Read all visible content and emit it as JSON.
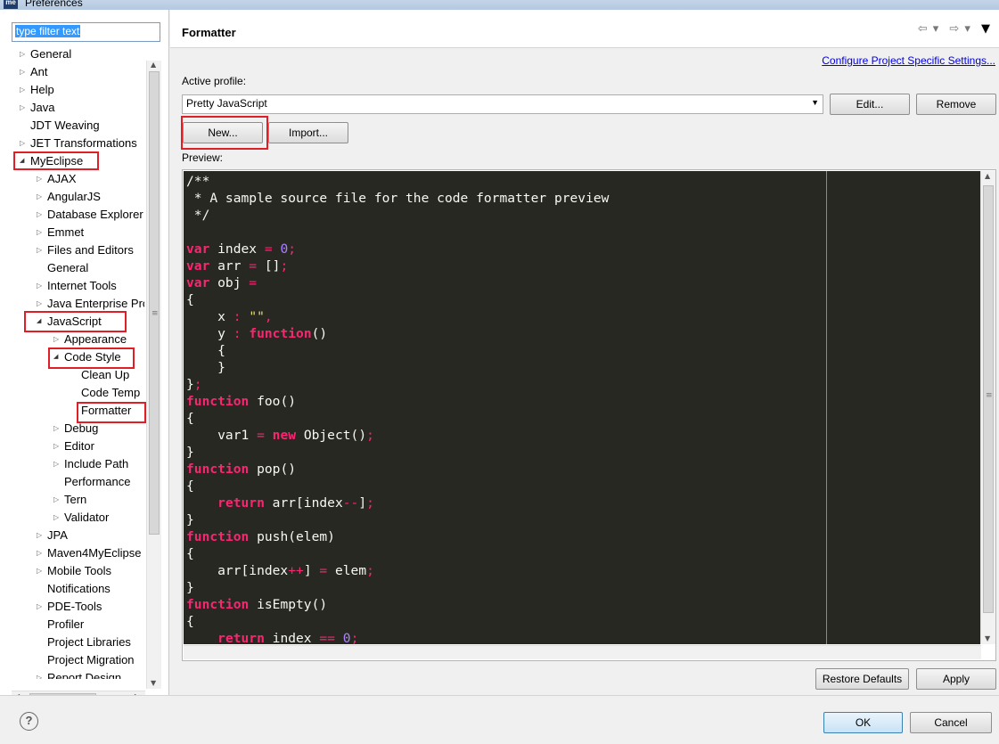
{
  "window": {
    "title": "Preferences",
    "app_icon": "me"
  },
  "filter": {
    "value": "type filter text"
  },
  "tree": [
    {
      "label": "General",
      "arrow": "▷",
      "level": 0
    },
    {
      "label": "Ant",
      "arrow": "▷",
      "level": 0
    },
    {
      "label": "Help",
      "arrow": "▷",
      "level": 0
    },
    {
      "label": "Java",
      "arrow": "▷",
      "level": 0
    },
    {
      "label": "JDT Weaving",
      "arrow": "",
      "level": 0
    },
    {
      "label": "JET Transformations",
      "arrow": "▷",
      "level": 0
    },
    {
      "label": "MyEclipse",
      "arrow": "◢",
      "level": 0
    },
    {
      "label": "AJAX",
      "arrow": "▷",
      "level": 1
    },
    {
      "label": "AngularJS",
      "arrow": "▷",
      "level": 1
    },
    {
      "label": "Database Explorer",
      "arrow": "▷",
      "level": 1
    },
    {
      "label": "Emmet",
      "arrow": "▷",
      "level": 1
    },
    {
      "label": "Files and Editors",
      "arrow": "▷",
      "level": 1
    },
    {
      "label": "General",
      "arrow": "",
      "level": 1
    },
    {
      "label": "Internet Tools",
      "arrow": "▷",
      "level": 1
    },
    {
      "label": "Java Enterprise Pro",
      "arrow": "▷",
      "level": 1
    },
    {
      "label": "JavaScript",
      "arrow": "◢",
      "level": 1
    },
    {
      "label": "Appearance",
      "arrow": "▷",
      "level": 2
    },
    {
      "label": "Code Style",
      "arrow": "◢",
      "level": 2
    },
    {
      "label": "Clean Up",
      "arrow": "",
      "level": 3
    },
    {
      "label": "Code Temp",
      "arrow": "",
      "level": 3
    },
    {
      "label": "Formatter",
      "arrow": "",
      "level": 3
    },
    {
      "label": "Debug",
      "arrow": "▷",
      "level": 2
    },
    {
      "label": "Editor",
      "arrow": "▷",
      "level": 2
    },
    {
      "label": "Include Path",
      "arrow": "▷",
      "level": 2
    },
    {
      "label": "Performance",
      "arrow": "",
      "level": 2
    },
    {
      "label": "Tern",
      "arrow": "▷",
      "level": 2
    },
    {
      "label": "Validator",
      "arrow": "▷",
      "level": 2
    },
    {
      "label": "JPA",
      "arrow": "▷",
      "level": 1
    },
    {
      "label": "Maven4MyEclipse",
      "arrow": "▷",
      "level": 1
    },
    {
      "label": "Mobile Tools",
      "arrow": "▷",
      "level": 1
    },
    {
      "label": "Notifications",
      "arrow": "",
      "level": 1
    },
    {
      "label": "PDE-Tools",
      "arrow": "▷",
      "level": 1
    },
    {
      "label": "Profiler",
      "arrow": "",
      "level": 1
    },
    {
      "label": "Project Libraries",
      "arrow": "",
      "level": 1
    },
    {
      "label": "Project Migration",
      "arrow": "",
      "level": 1
    },
    {
      "label": "Report Design",
      "arrow": "▷",
      "level": 1
    }
  ],
  "page": {
    "title": "Formatter",
    "config_link": "Configure Project Specific Settings...",
    "active_profile_label": "Active profile:",
    "profile_value": "Pretty JavaScript",
    "edit_label": "Edit...",
    "remove_label": "Remove",
    "new_label": "New...",
    "import_label": "Import...",
    "preview_label": "Preview:",
    "restore_defaults_label": "Restore Defaults",
    "apply_label": "Apply"
  },
  "code_lines": [
    [
      [
        "cmt",
        "/**"
      ]
    ],
    [
      [
        "cmt",
        " * A sample source file for the code formatter preview"
      ]
    ],
    [
      [
        "cmt",
        " */"
      ]
    ],
    [],
    [
      [
        "kw",
        "var"
      ],
      [
        "",
        " index "
      ],
      [
        "op",
        "="
      ],
      [
        "",
        " "
      ],
      [
        "num",
        "0"
      ],
      [
        "op",
        ";"
      ]
    ],
    [
      [
        "kw",
        "var"
      ],
      [
        "",
        " arr "
      ],
      [
        "op",
        "="
      ],
      [
        "",
        " []"
      ],
      [
        "op",
        ";"
      ]
    ],
    [
      [
        "kw",
        "var"
      ],
      [
        "",
        " obj "
      ],
      [
        "op",
        "="
      ]
    ],
    [
      [
        "",
        "{"
      ]
    ],
    [
      [
        "",
        "    x "
      ],
      [
        "op",
        ":"
      ],
      [
        "",
        " "
      ],
      [
        "str",
        "\"\""
      ],
      [
        "op",
        ","
      ]
    ],
    [
      [
        "",
        "    y "
      ],
      [
        "op",
        ":"
      ],
      [
        "",
        " "
      ],
      [
        "kw",
        "function"
      ],
      [
        "",
        "()"
      ]
    ],
    [
      [
        "",
        "    {"
      ]
    ],
    [
      [
        "",
        "    }"
      ]
    ],
    [
      [
        "",
        "}"
      ],
      [
        "op",
        ";"
      ]
    ],
    [
      [
        "kw",
        "function"
      ],
      [
        "",
        " foo()"
      ]
    ],
    [
      [
        "",
        "{"
      ]
    ],
    [
      [
        "",
        "    var1 "
      ],
      [
        "op",
        "="
      ],
      [
        "",
        " "
      ],
      [
        "kw",
        "new"
      ],
      [
        "",
        " Object()"
      ],
      [
        "op",
        ";"
      ]
    ],
    [
      [
        "",
        "}"
      ]
    ],
    [
      [
        "kw",
        "function"
      ],
      [
        "",
        " pop()"
      ]
    ],
    [
      [
        "",
        "{"
      ]
    ],
    [
      [
        "",
        "    "
      ],
      [
        "kw",
        "return"
      ],
      [
        "",
        " arr[index"
      ],
      [
        "op",
        "--"
      ],
      [
        "",
        "]"
      ],
      [
        "op",
        ";"
      ]
    ],
    [
      [
        "",
        "}"
      ]
    ],
    [
      [
        "kw",
        "function"
      ],
      [
        "",
        " push(elem)"
      ]
    ],
    [
      [
        "",
        "{"
      ]
    ],
    [
      [
        "",
        "    arr[index"
      ],
      [
        "op",
        "++"
      ],
      [
        "",
        "] "
      ],
      [
        "op",
        "="
      ],
      [
        "",
        " elem"
      ],
      [
        "op",
        ";"
      ]
    ],
    [
      [
        "",
        "}"
      ]
    ],
    [
      [
        "kw",
        "function"
      ],
      [
        "",
        " isEmpty()"
      ]
    ],
    [
      [
        "",
        "{"
      ]
    ],
    [
      [
        "",
        "    "
      ],
      [
        "kw",
        "return"
      ],
      [
        "",
        " index "
      ],
      [
        "op",
        "=="
      ],
      [
        "",
        " "
      ],
      [
        "num",
        "0"
      ],
      [
        "op",
        ";"
      ]
    ]
  ],
  "dialog": {
    "ok_label": "OK",
    "cancel_label": "Cancel",
    "help_glyph": "?"
  },
  "colors": {
    "highlight": "#e01e25",
    "editor_bg": "#272822",
    "keyword": "#f92672",
    "string": "#e6db74",
    "number": "#ae81ff",
    "link": "#0000e0"
  }
}
